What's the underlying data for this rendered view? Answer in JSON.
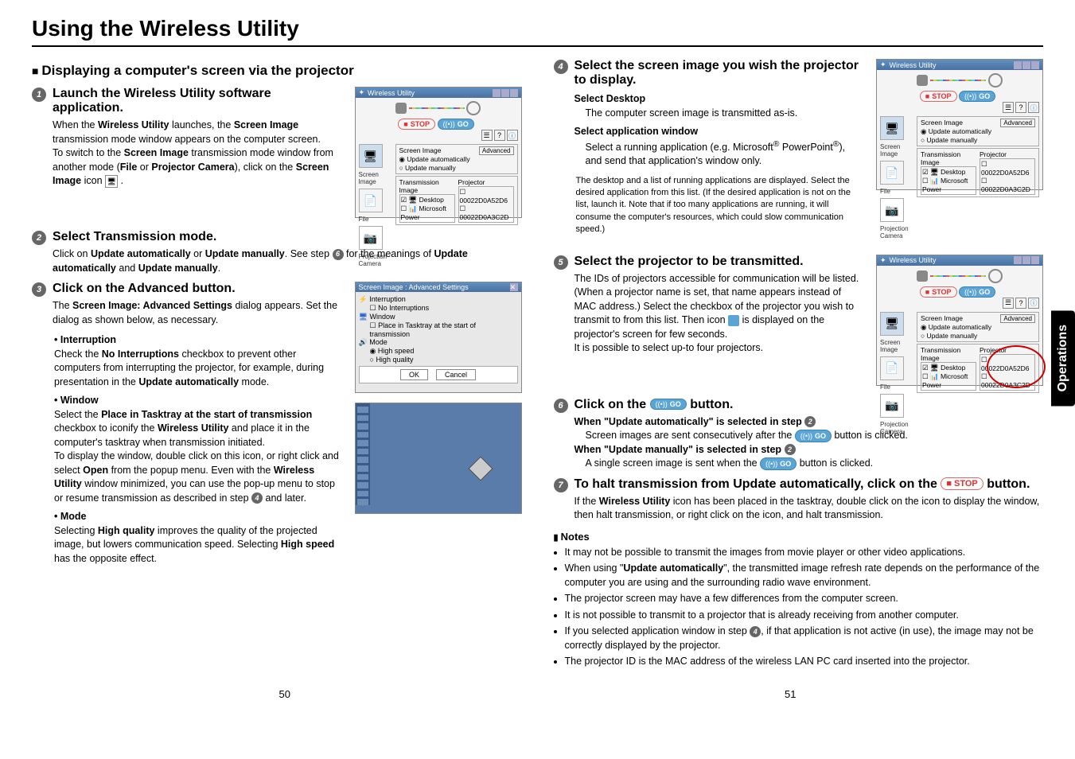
{
  "title": "Using the Wireless Utility",
  "sectionHeading": "Displaying a computer's screen via the projector",
  "sideTab": "Operations",
  "pageLeft": "50",
  "pageRight": "51",
  "steps": {
    "s1": {
      "num": "1",
      "title": "Launch the Wireless Utility software application.",
      "body1a": "When the ",
      "body1b": "Wireless Utility",
      "body1c": " launches, the ",
      "body1d": "Screen Image",
      "body1e": " transmission mode window appears on the computer screen.",
      "body2a": "To switch to the ",
      "body2b": "Screen Image",
      "body2c": " transmission mode window from another mode (",
      "body2d": "File",
      "body2e": " or ",
      "body2f": "Projector Camera",
      "body2g": "), click on the ",
      "body2h": "Screen Image",
      "body2i": " icon "
    },
    "s2": {
      "num": "2",
      "title": "Select Transmission mode.",
      "body1a": "Click on ",
      "body1b": "Update automatically",
      "body1c": " or ",
      "body1d": "Update manually",
      "body1e": ". See step ",
      "body1f": " for the meanings of ",
      "body1g": "Update automatically",
      "body1h": " and ",
      "body1i": "Update manually",
      "body1j": "."
    },
    "s3": {
      "num": "3",
      "title": "Click on the Advanced button.",
      "body1a": "The ",
      "body1b": "Screen Image: Advanced Settings",
      "body1c": " dialog appears. Set the dialog as shown below, as necessary.",
      "bulInterruption": "Interruption",
      "interruption_a": "Check the ",
      "interruption_b": "No Interruptions",
      "interruption_c": " checkbox to prevent other computers from interrupting the projector, for example, during presentation in the ",
      "interruption_d": "Update automatically",
      "interruption_e": " mode.",
      "bulWindow": "Window",
      "window_a": "Select the ",
      "window_b": "Place in Tasktray at the start of transmission",
      "window_c": " checkbox to iconify the ",
      "window_d": "Wireless Utility",
      "window_e": " and place it in the computer's tasktray when transmission initiated.",
      "window_f": "To display the window, double click on this icon, or right click and select ",
      "window_g": "Open",
      "window_h": " from the popup menu. Even with the ",
      "window_i": "Wireless Utility",
      "window_j": " window minimized, you can use the pop-up menu to stop or resume transmission as described in step ",
      "window_k": " and later.",
      "bulMode": "Mode",
      "mode_a": "Selecting ",
      "mode_b": "High quality",
      "mode_c": " improves the quality of the projected image, but lowers communication speed. Selecting ",
      "mode_d": "High speed",
      "mode_e": " has the opposite effect."
    },
    "s4": {
      "num": "4",
      "title": "Select the screen image you wish the projector to display.",
      "subDesktop": "Select Desktop",
      "desktopBody": "The computer screen image is transmitted as-is.",
      "subAppWin": "Select application window",
      "appBody1": "Select a running application (e.g. Microsoft",
      "appBody1sup": "®",
      "appBody2": " PowerPoint",
      "appBody2sup": "®",
      "appBody3": "), and send that application's window only.",
      "small": "The desktop and a list of running applications are displayed. Select the desired application from this list. (If the desired application is not on the list, launch it. Note that if too many applications are running, it will consume the computer's resources, which could slow communication speed.)"
    },
    "s5": {
      "num": "5",
      "title": "Select the projector to be transmitted.",
      "body1": "The IDs of projectors accessible for communication will be listed. (When a projector name is set, that name appears instead of MAC address.) Select the checkbox of the projector you wish to transmit to from this list. Then icon ",
      "body2": " is displayed on the projector's screen for few seconds.",
      "body3": "It is possible to select up-to four projectors."
    },
    "s6": {
      "num": "6",
      "titleA": "Click on the ",
      "titleB": " button.",
      "uaHead1": "When \"Update automatically\" is selected in step ",
      "uaBody1": "Screen images are sent consecutively after the ",
      "uaBody2": " button is clicked.",
      "umHead1": "When \"Update manually\" is selected in step ",
      "umBody1": "A single screen image is sent when the ",
      "umBody2": " button is clicked."
    },
    "s7": {
      "num": "7",
      "titleA": "To halt transmission from Update automatically, click on the ",
      "titleB": " button.",
      "body1a": "If the ",
      "body1b": "Wireless Utility",
      "body1c": " icon has been placed in the tasktray, double click on the icon to display the window, then halt transmission, or right click on the icon, and halt transmission."
    }
  },
  "notes": {
    "heading": "Notes",
    "n1": "It may not be possible to transmit the images from movie player or other video applications.",
    "n2a": "When using \"",
    "n2b": "Update automatically",
    "n2c": "\", the transmitted image refresh rate depends on the performance of the computer you are using and the surrounding radio wave environment.",
    "n3": "The projector screen may have a few differences from the computer screen.",
    "n4": "It is not possible to transmit to a projector that is already receiving from another computer.",
    "n5a": "If you selected application window in step ",
    "n5b": ", if that application is not active (in use), the image may not be correctly displayed by the projector.",
    "n6": "The projector ID is the MAC address of the wireless LAN PC card inserted into the projector."
  },
  "fig": {
    "utilTitle": "Wireless Utility",
    "stop": "STOP",
    "go": "GO",
    "screenImageTab": "Screen Image",
    "fileTab": "File",
    "projCameraTab": "Projection Camera",
    "screenImageLabel": "Screen Image",
    "updateAuto": "Update automatically",
    "updateManual": "Update manually",
    "transmissionImage": "Transmission Image",
    "desktop": "Desktop",
    "microsoftPower": "Microsoft Power",
    "projectorLabel": "Projector",
    "proj1": "00022D0A52D6",
    "proj2": "00022D0A3C2D",
    "advancedBtn": "Advanced",
    "advTitle": "Screen Image : Advanced Settings",
    "advInterruption": "Interruption",
    "advNoInt": "No Interruptions",
    "advWindow": "Window",
    "advPlaceTask": "Place in Tasktray at the start of transmission",
    "advMode": "Mode",
    "advHighSpeed": "High speed",
    "advHighQuality": "High quality",
    "ok": "OK",
    "cancel": "Cancel"
  },
  "stepRefs": {
    "r2": "2",
    "r4": "4",
    "r6": "6"
  }
}
